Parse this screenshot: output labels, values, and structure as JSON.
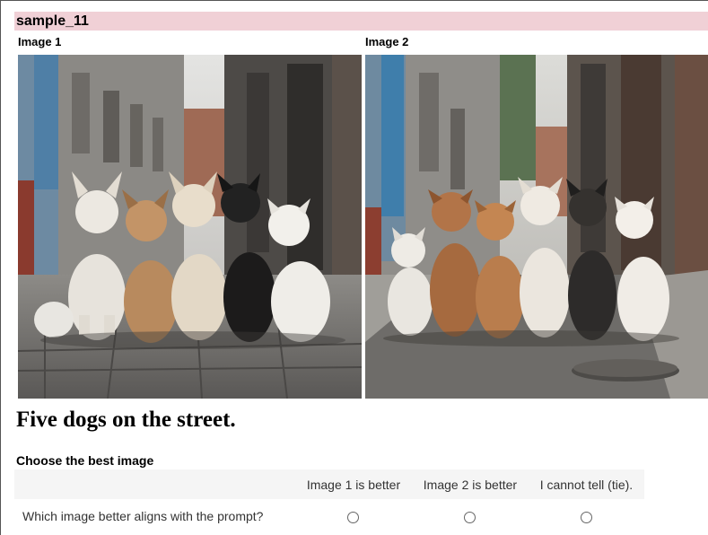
{
  "sample_title": "sample_11",
  "images": [
    {
      "label": "Image 1"
    },
    {
      "label": "Image 2"
    }
  ],
  "prompt": "Five dogs on the street.",
  "survey": {
    "title": "Choose the best image",
    "options": [
      "Image 1 is better",
      "Image 2 is better",
      "I cannot tell (tie)."
    ],
    "question": "Which image better aligns with the prompt?",
    "selected": null
  },
  "colors": {
    "header_bg": "#f0d0d6",
    "table_header_bg": "#f5f5f5"
  }
}
